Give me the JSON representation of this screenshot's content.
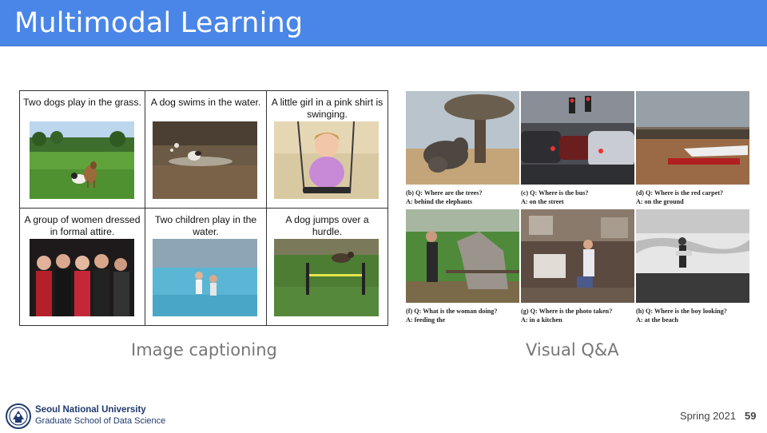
{
  "slide": {
    "title": "Multimodal Learning",
    "term": "Spring 2021",
    "page_number": "59"
  },
  "captioning": {
    "label": "Image captioning",
    "items": [
      {
        "caption": "Two dogs play in the grass.",
        "image": "two-dogs-grass-photo"
      },
      {
        "caption": "A dog swims in the water.",
        "image": "dog-swimming-photo"
      },
      {
        "caption": "A little girl in a pink shirt is swinging.",
        "image": "girl-swinging-photo"
      },
      {
        "caption": "A group of women dressed in formal attire.",
        "image": "group-of-women-photo"
      },
      {
        "caption": "Two children play in the water.",
        "image": "children-water-photo"
      },
      {
        "caption": "A dog jumps over a hurdle.",
        "image": "dog-hurdle-photo"
      }
    ]
  },
  "vqa": {
    "label": "Visual Q&A",
    "items": [
      {
        "question": "(b) Q: Where are the trees?",
        "answer": "A: behind the elephants",
        "image": "elephants-tree-photo"
      },
      {
        "question": "(c) Q: Where is the bus?",
        "answer": "A: on the street",
        "image": "street-traffic-photo"
      },
      {
        "question": "(d) Q: Where is the red carpet?",
        "answer": "A: on the ground",
        "image": "airplane-carpet-photo"
      },
      {
        "question": "(f) Q: What is the woman doing?",
        "answer": "A: feeding the",
        "image": "woman-horse-photo"
      },
      {
        "question": "(g) Q: Where is the photo taken?",
        "answer": "A: in a kitchen",
        "image": "kitchen-photo"
      },
      {
        "question": "(h) Q: Where is the boy looking?",
        "answer": "A: at the beach",
        "image": "boy-beach-photo"
      }
    ]
  },
  "footer": {
    "university": "Seoul National University",
    "school": "Graduate School of Data Science",
    "logo_icon": "snu-emblem-icon"
  },
  "colors": {
    "title_bar": "#4a86e8",
    "label_gray": "#777777",
    "footer_blue": "#1f3a6e"
  }
}
